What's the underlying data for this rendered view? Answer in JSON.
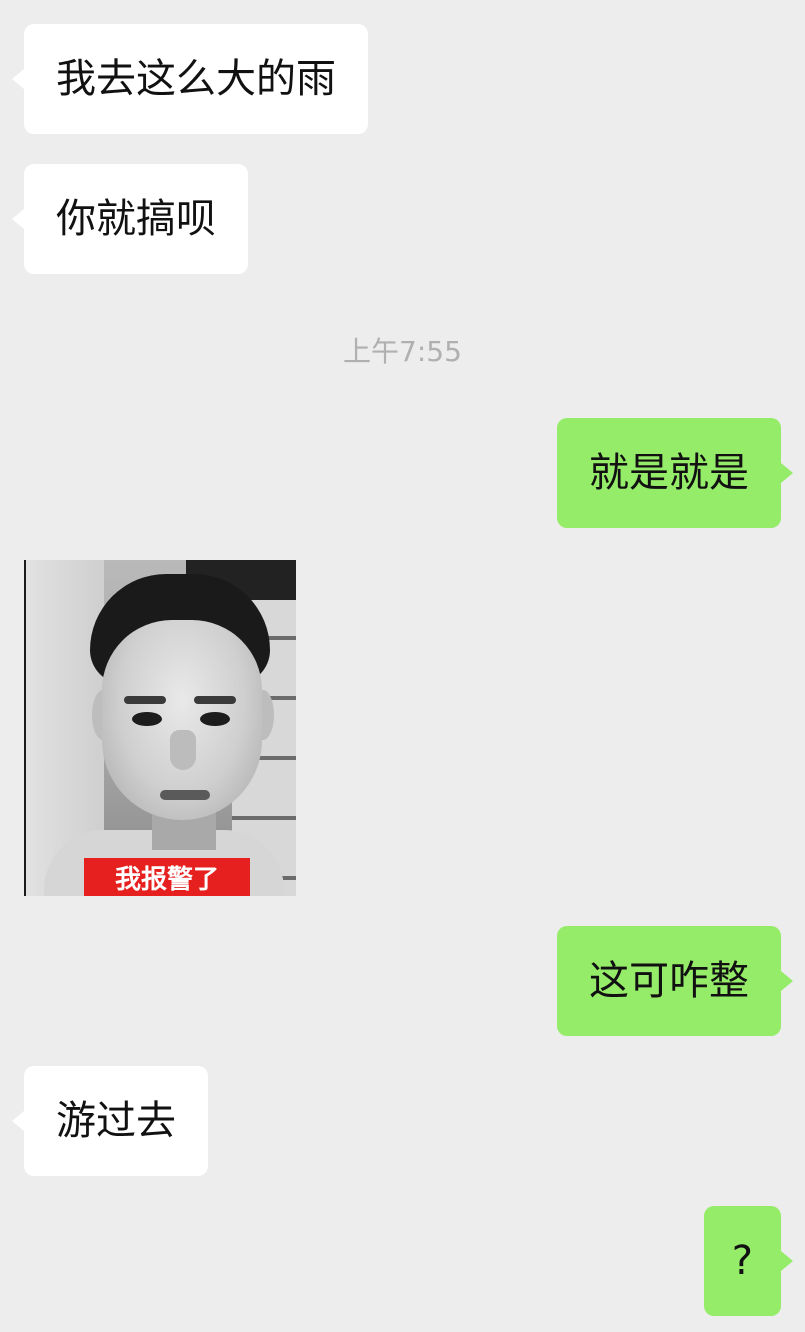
{
  "messages": [
    {
      "side": "incoming",
      "text": "我去这么大的雨"
    },
    {
      "side": "incoming",
      "text": "你就搞呗"
    },
    {
      "side": "outgoing",
      "text": "就是就是"
    },
    {
      "side": "incoming",
      "sticker_caption": "我报警了"
    },
    {
      "side": "outgoing",
      "text": "这可咋整"
    },
    {
      "side": "incoming",
      "text": "游过去"
    },
    {
      "side": "outgoing",
      "text": "?"
    }
  ],
  "timestamp": "上午7:55",
  "colors": {
    "background": "#ededed",
    "incoming_bubble": "#ffffff",
    "outgoing_bubble": "#95ec69",
    "timestamp_text": "#b0b0b0",
    "sticker_caption_bg": "#e5201f"
  }
}
